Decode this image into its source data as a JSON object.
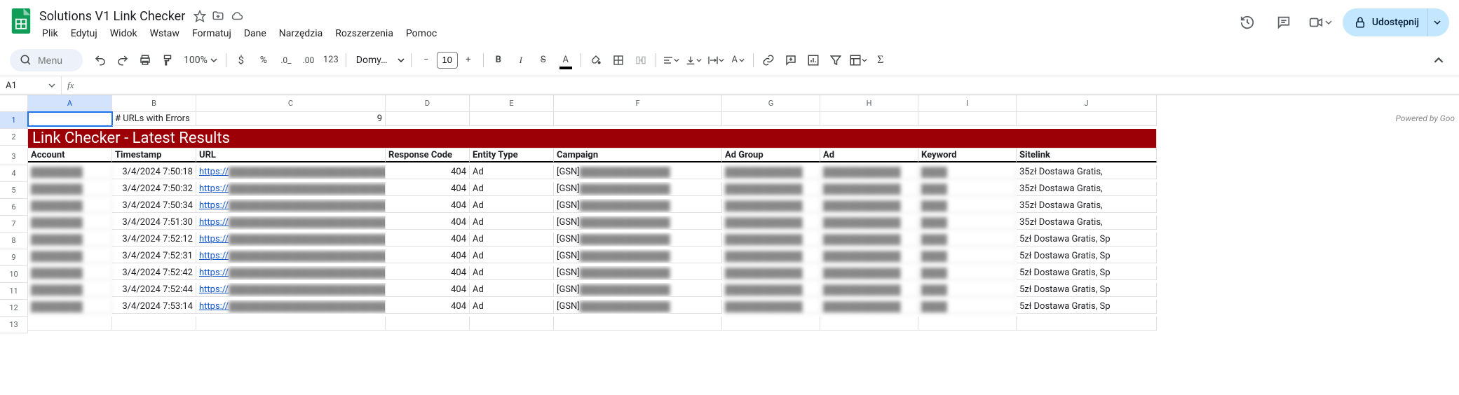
{
  "doc": {
    "title": "Solutions V1 Link Checker"
  },
  "menus": [
    "Plik",
    "Edytuj",
    "Widok",
    "Wstaw",
    "Formatuj",
    "Dane",
    "Narzędzia",
    "Rozszerzenia",
    "Pomoc"
  ],
  "share": {
    "label": "Udostępnij"
  },
  "toolbar": {
    "search_placeholder": "Menu",
    "zoom": "100%",
    "font": "Domy…",
    "font_size": "10",
    "number_fmt": "123"
  },
  "name_box": "A1",
  "columns": [
    "A",
    "B",
    "C",
    "D",
    "E",
    "F",
    "G",
    "H",
    "I",
    "J"
  ],
  "powered": "Powered by Goo",
  "row1": {
    "label": "# URLs with Errors",
    "count": "9"
  },
  "title_row": "Link Checker - Latest Results",
  "headers": [
    "Account",
    "Timestamp",
    "URL",
    "Response Code",
    "Entity Type",
    "Campaign",
    "Ad Group",
    "Ad",
    "Keyword",
    "Sitelink"
  ],
  "rows": [
    {
      "ts": "3/4/2024 7:50:18",
      "url": "https://",
      "rc": "404",
      "et": "Ad",
      "cp": "[GSN]",
      "site": "35zł Dostawa Gratis,"
    },
    {
      "ts": "3/4/2024 7:50:32",
      "url": "https://",
      "rc": "404",
      "et": "Ad",
      "cp": "[GSN]",
      "site": "35zł Dostawa Gratis,"
    },
    {
      "ts": "3/4/2024 7:50:34",
      "url": "https://",
      "rc": "404",
      "et": "Ad",
      "cp": "[GSN]",
      "site": "35zł Dostawa Gratis,"
    },
    {
      "ts": "3/4/2024 7:51:30",
      "url": "https://",
      "rc": "404",
      "et": "Ad",
      "cp": "[GSN]",
      "site": "35zł Dostawa Gratis,"
    },
    {
      "ts": "3/4/2024 7:52:12",
      "url": "https://",
      "rc": "404",
      "et": "Ad",
      "cp": "[GSN]",
      "site": "5zł Dostawa Gratis, Sp"
    },
    {
      "ts": "3/4/2024 7:52:31",
      "url": "https://",
      "rc": "404",
      "et": "Ad",
      "cp": "[GSN]",
      "site": "5zł Dostawa Gratis, Sp"
    },
    {
      "ts": "3/4/2024 7:52:42",
      "url": "https://",
      "rc": "404",
      "et": "Ad",
      "cp": "[GSN]",
      "site": "5zł Dostawa Gratis, Sp"
    },
    {
      "ts": "3/4/2024 7:52:44",
      "url": "https://",
      "rc": "404",
      "et": "Ad",
      "cp": "[GSN]",
      "site": "5zł Dostawa Gratis, Sp"
    },
    {
      "ts": "3/4/2024 7:53:14",
      "url": "https://",
      "rc": "404",
      "et": "Ad",
      "cp": "[GSN]",
      "site": "5zł Dostawa Gratis, Sp"
    }
  ]
}
